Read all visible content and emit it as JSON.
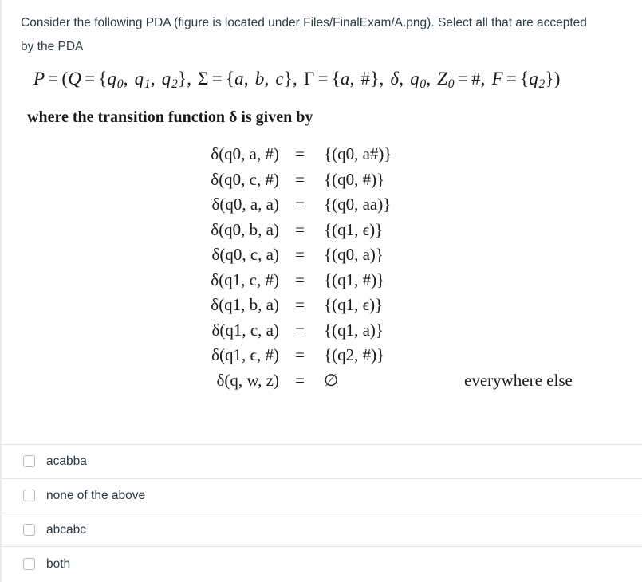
{
  "question": {
    "prompt": "Consider the following PDA (figure is located under Files/FinalExam/A.png). Select all that are accepted by the PDA",
    "where_text": "where the transition function δ is given by"
  },
  "pda_definition": {
    "name": "P",
    "states_label": "Q",
    "states": [
      "q0",
      "q1",
      "q2"
    ],
    "input_alphabet_label": "Σ",
    "input_alphabet": [
      "a",
      "b",
      "c"
    ],
    "stack_alphabet_label": "Γ",
    "stack_alphabet": [
      "a",
      "#"
    ],
    "transition_symbol": "δ",
    "start_state": "q0",
    "initial_stack_symbol_label": "Z0",
    "initial_stack_symbol": "#",
    "final_states_label": "F",
    "final_states": [
      "q2"
    ],
    "plain_text": "P = (Q = {q0, q1, q2}, Σ = {a, b, c}, Γ = {a, #}, δ, q0, Z0 = #, F = {q2})"
  },
  "transitions": {
    "equals_sign": "=",
    "rows": [
      {
        "lhs": "δ(q0, a, #)",
        "state": "q0",
        "input": "a",
        "stack": "#",
        "rhs": "{(q0, a#)}",
        "next_state": "q0",
        "push": "a#",
        "note": ""
      },
      {
        "lhs": "δ(q0, c, #)",
        "state": "q0",
        "input": "c",
        "stack": "#",
        "rhs": "{(q0, #)}",
        "next_state": "q0",
        "push": "#",
        "note": ""
      },
      {
        "lhs": "δ(q0, a, a)",
        "state": "q0",
        "input": "a",
        "stack": "a",
        "rhs": "{(q0, aa)}",
        "next_state": "q0",
        "push": "aa",
        "note": ""
      },
      {
        "lhs": "δ(q0, b, a)",
        "state": "q0",
        "input": "b",
        "stack": "a",
        "rhs": "{(q1, ϵ)}",
        "next_state": "q1",
        "push": "ϵ",
        "note": ""
      },
      {
        "lhs": "δ(q0, c, a)",
        "state": "q0",
        "input": "c",
        "stack": "a",
        "rhs": "{(q0, a)}",
        "next_state": "q0",
        "push": "a",
        "note": ""
      },
      {
        "lhs": "δ(q1, c, #)",
        "state": "q1",
        "input": "c",
        "stack": "#",
        "rhs": "{(q1, #)}",
        "next_state": "q1",
        "push": "#",
        "note": ""
      },
      {
        "lhs": "δ(q1, b, a)",
        "state": "q1",
        "input": "b",
        "stack": "a",
        "rhs": "{(q1, ϵ)}",
        "next_state": "q1",
        "push": "ϵ",
        "note": ""
      },
      {
        "lhs": "δ(q1, c, a)",
        "state": "q1",
        "input": "c",
        "stack": "a",
        "rhs": "{(q1, a)}",
        "next_state": "q1",
        "push": "a",
        "note": ""
      },
      {
        "lhs": "δ(q1, ϵ, #)",
        "state": "q1",
        "input": "ϵ",
        "stack": "#",
        "rhs": "{(q2, #)}",
        "next_state": "q2",
        "push": "#",
        "note": ""
      },
      {
        "lhs": "δ(q, w, z)",
        "state": "q",
        "input": "w",
        "stack": "z",
        "rhs": "∅",
        "next_state": "",
        "push": "",
        "note": "everywhere else"
      }
    ]
  },
  "answers": {
    "options": [
      {
        "label": "acabba",
        "checked": false
      },
      {
        "label": "none of the above",
        "checked": false
      },
      {
        "label": "abcabc",
        "checked": false
      },
      {
        "label": "both",
        "checked": false
      }
    ]
  },
  "colors": {
    "text": "#2d3b45",
    "math_text": "#1b1b1b",
    "divider": "#e3e5e7",
    "checkbox_border": "#b7bdc2",
    "background": "#ffffff"
  }
}
